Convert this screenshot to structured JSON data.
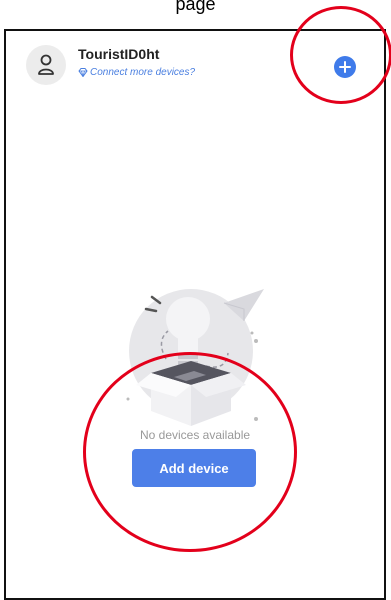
{
  "caption": "page",
  "header": {
    "username": "TouristID0ht",
    "connect_text": "Connect more devices?"
  },
  "empty_state": {
    "message": "No devices available",
    "add_button_label": "Add device"
  },
  "icons": {
    "avatar": "person-icon",
    "connect": "diamond-icon",
    "add": "plus-circle-icon",
    "illustration": "lightbulb-box-icon"
  },
  "colors": {
    "accent": "#4d7fe8",
    "annotation": "#e3001b"
  }
}
